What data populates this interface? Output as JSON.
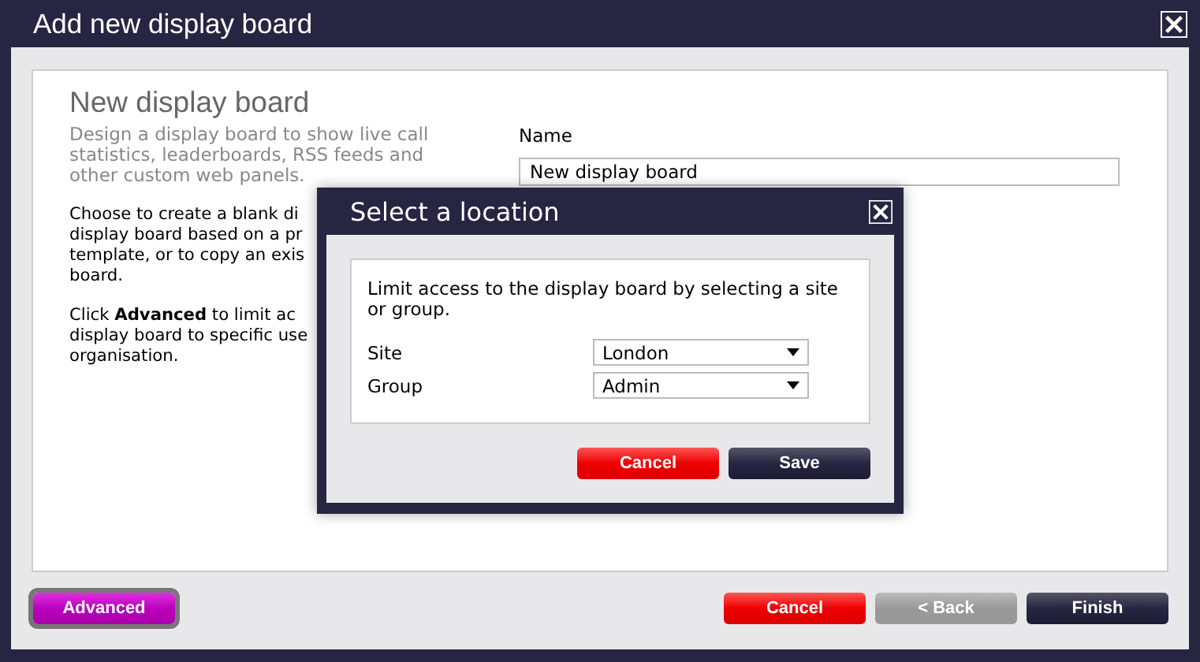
{
  "window": {
    "title": "Add new display board"
  },
  "panel": {
    "heading": "New display board",
    "intro": "Design a display board to show live call statistics, leaderboards, RSS feeds and other custom web panels.",
    "paragraphs": [
      {
        "lines": [
          "Choose to create a blank di",
          "display board based on a pr",
          "template, or to copy an exis",
          "board."
        ]
      },
      {
        "lines": [
          "Click **Advanced** to limit ac",
          "display board to specific use",
          "organisation."
        ]
      }
    ],
    "name_field": {
      "label": "Name",
      "value": "New display board"
    }
  },
  "footer": {
    "buttons": [
      {
        "label": "Advanced",
        "kind": "advanced",
        "focused": true
      },
      {
        "label": "Cancel",
        "kind": "danger",
        "focused": false
      },
      {
        "label": "< Back",
        "kind": "disabled",
        "focused": false
      },
      {
        "label": "Finish",
        "kind": "dark",
        "focused": false
      }
    ]
  },
  "dialog": {
    "title": "Select a location",
    "text": "Limit access to the display board by selecting a site or group.",
    "fields": [
      {
        "label": "Site",
        "value": "London"
      },
      {
        "label": "Group",
        "value": "Admin"
      }
    ],
    "buttons": [
      {
        "label": "Cancel",
        "kind": "danger"
      },
      {
        "label": "Save",
        "kind": "dark"
      }
    ]
  }
}
